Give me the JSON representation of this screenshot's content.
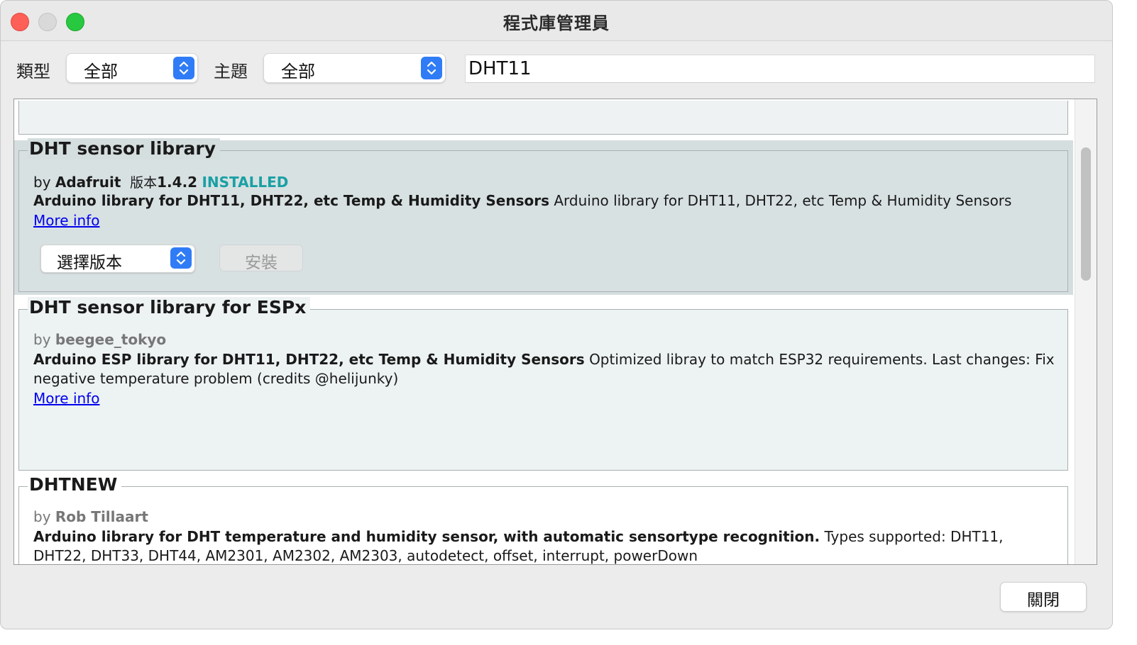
{
  "window": {
    "title": "程式庫管理員"
  },
  "filters": {
    "type_label": "類型",
    "type_value": "全部",
    "topic_label": "主題",
    "topic_value": "全部",
    "search_value": "DHT11"
  },
  "libraries": [
    {
      "name": "DHT sensor library",
      "by_prefix": "by",
      "author": "Adafruit",
      "version_label": "版本",
      "version": "1.4.2",
      "status": "INSTALLED",
      "summary": "Arduino library for DHT11, DHT22, etc Temp & Humidity Sensors",
      "description": "Arduino library for DHT11, DHT22, etc Temp & Humidity Sensors",
      "more_info": "More info",
      "version_select": "選擇版本",
      "install_label": "安裝"
    },
    {
      "name": "DHT sensor library for ESPx",
      "by_prefix": "by",
      "author": "beegee_tokyo",
      "summary": "Arduino ESP library for DHT11, DHT22, etc Temp & Humidity Sensors",
      "description": "Optimized libray to match ESP32 requirements. Last changes: Fix negative temperature problem (credits @helijunky)",
      "more_info": "More info"
    },
    {
      "name": "DHTNEW",
      "by_prefix": "by",
      "author": "Rob Tillaart",
      "summary": "Arduino library for DHT temperature and humidity sensor, with automatic sensortype recognition.",
      "description": "Types supported: DHT11, DHT22, DHT33, DHT44, AM2301, AM2302, AM2303, autodetect, offset, interrupt, powerDown"
    }
  ],
  "footer": {
    "close_label": "關閉"
  },
  "colors": {
    "installed": "#1aa0a4",
    "link": "#0000ee",
    "stepper": "#2f7cf6",
    "selected_card": "#d5dedf"
  }
}
